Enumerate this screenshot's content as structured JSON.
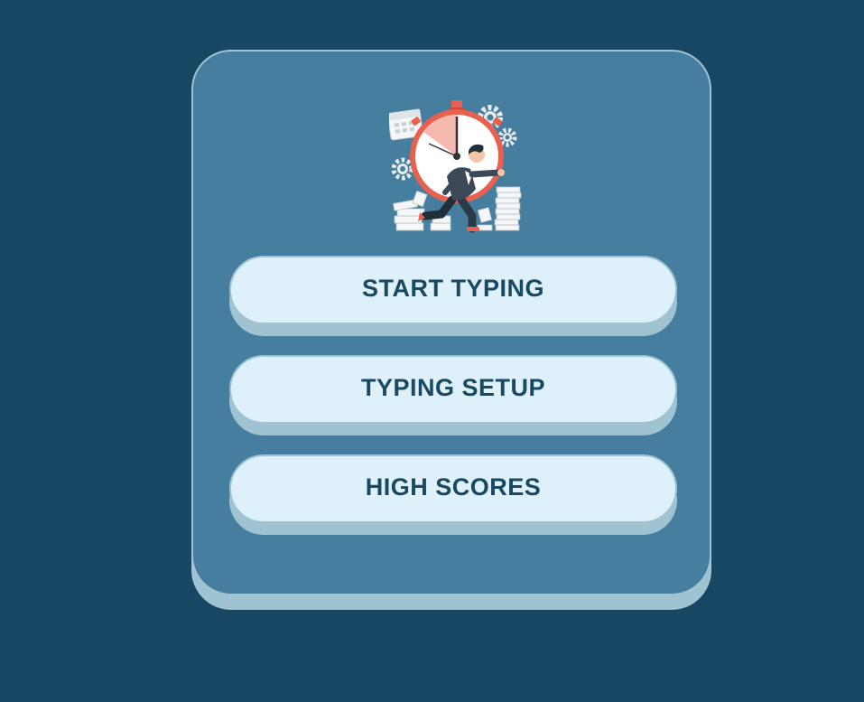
{
  "menu": {
    "start_label": "START TYPING",
    "setup_label": "TYPING SETUP",
    "scores_label": "HIGH SCORES"
  },
  "illustration": {
    "icon": "stopwatch-runner-illustration"
  },
  "colors": {
    "background": "#184763",
    "card": "#467e9f",
    "card_border": "#9fc3d1",
    "button": "#def1fb",
    "button_text": "#194862",
    "accent": "#e8604f"
  }
}
